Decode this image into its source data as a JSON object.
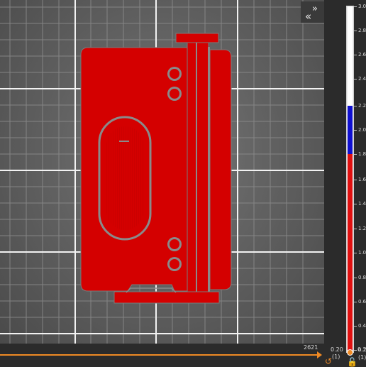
{
  "viewport": {
    "bed_color": "#686868",
    "model_color": "#d40000",
    "gap_color": "#8a8a8a"
  },
  "collapse_button": {
    "icon": "collapse-sidebar-icon"
  },
  "layer_slider": {
    "ticks": [
      "3.0",
      "2.8",
      "2.6",
      "2.4",
      "2.2",
      "2.0",
      "1.8",
      "1.6",
      "1.4",
      "1.2",
      "1.0",
      "0.8",
      "0.6",
      "0.4",
      "0.2"
    ],
    "bottom_labels": {
      "value": "0.20",
      "index": "(1)"
    },
    "colors": {
      "top": "#ffffff",
      "selected": "#1010d0",
      "lower": "#e01010",
      "handle": "#f08a24"
    }
  },
  "move_slider": {
    "count": "2621",
    "left_label": {
      "value": "0.20",
      "index": "(1)"
    }
  }
}
